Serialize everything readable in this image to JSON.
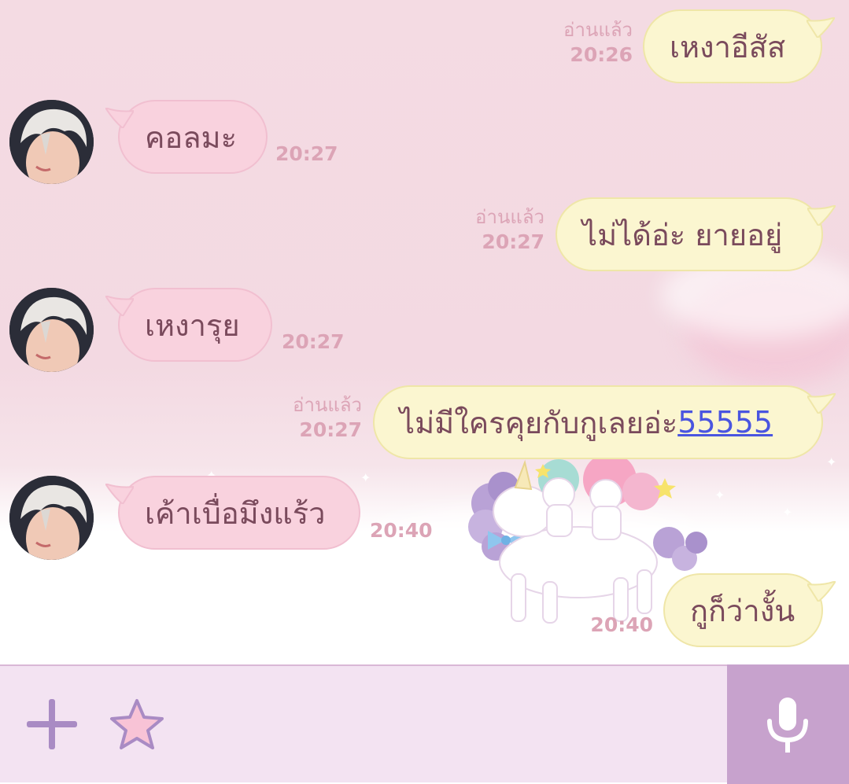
{
  "messages": [
    {
      "id": "m1",
      "side": "out",
      "text": "เหงาอีสัส",
      "read": "อ่านแล้ว",
      "time": "20:26"
    },
    {
      "id": "m2",
      "side": "in",
      "text": "คอลมะ",
      "time": "20:27"
    },
    {
      "id": "m3",
      "side": "out",
      "text": "ไม่ได้อ่ะ ยายอยู่",
      "read": "อ่านแล้ว",
      "time": "20:27"
    },
    {
      "id": "m4",
      "side": "in",
      "text": "เหงารุย",
      "time": "20:27"
    },
    {
      "id": "m5",
      "side": "out",
      "text": "ไม่มีใครคุยกับกูเลยอ่ะ",
      "link": "55555",
      "read": "อ่านแล้ว",
      "time": "20:27"
    },
    {
      "id": "m6",
      "side": "in",
      "text": "เค้าเบื่อมึงแร้ว",
      "time": "20:40"
    },
    {
      "id": "m7",
      "side": "out",
      "text": "กูก็ว่างั้น",
      "time": "20:40"
    }
  ],
  "icons": {
    "plus": "plus-icon",
    "sticker": "star-sticker-icon",
    "mic": "microphone-icon"
  },
  "colors": {
    "outgoing_bubble": "#fbf6d0",
    "incoming_bubble": "#f9d2de",
    "meta_text": "#dca4b6",
    "input_bar": "#f3e3f2",
    "mic_button": "#c7a2cd",
    "icon_purple": "#a98bc4"
  }
}
